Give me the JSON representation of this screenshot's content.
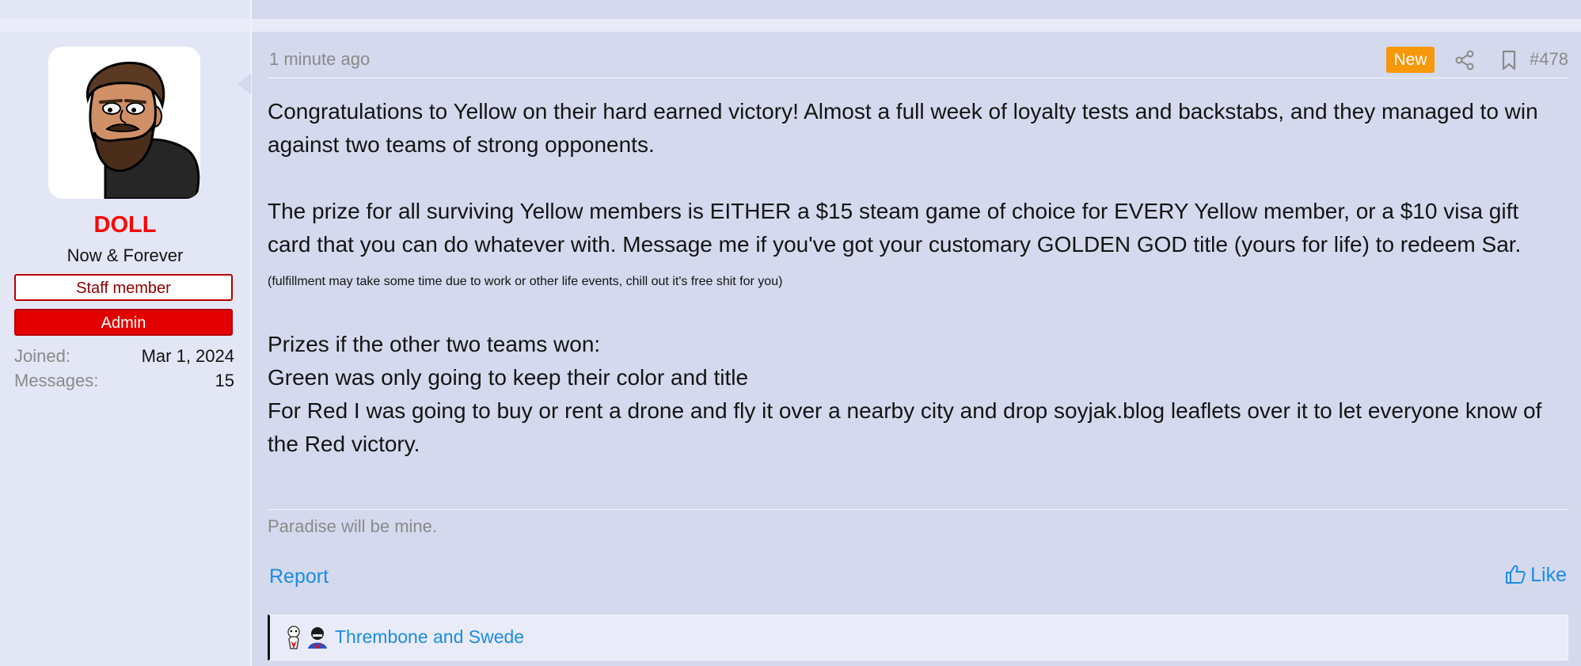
{
  "user": {
    "name": "DOLL",
    "title": "Now & Forever",
    "banners": [
      "Staff member",
      "Admin"
    ],
    "stats": [
      {
        "label": "Joined:",
        "value": "Mar 1, 2024"
      },
      {
        "label": "Messages:",
        "value": "15"
      }
    ],
    "avatar_icon": "bearded-man-avatar",
    "name_color": "#ff0000"
  },
  "post": {
    "time": "1 minute ago",
    "new_badge": "New",
    "number": "#478",
    "icons": [
      "share-icon",
      "bookmark-icon"
    ],
    "paragraph1": "Congratulations to Yellow on their hard earned victory! Almost a full week of loyalty tests and backstabs, and they managed to win against two teams of strong opponents.",
    "paragraph2": "The prize for all surviving Yellow members is EITHER a $15 steam game of choice for EVERY Yellow member, or a $10 visa gift card that you can do whatever with. Message me if you've got your customary GOLDEN GOD title (yours for life) to redeem Sar.",
    "small_note": "(fulfillment may take some time due to work or other life events, chill out it's free shit for you)",
    "lines": [
      "Prizes if the other two teams won:",
      "Green was only going to keep their color and title",
      "For Red I was going to buy or rent a drone and fly it over a nearby city and drop soyjak.blog leaflets over it to let everyone know of the Red victory."
    ],
    "signature": "Paradise will be mine."
  },
  "actions": {
    "report": "Report",
    "like": "Like"
  },
  "reactions": {
    "users": "Thrembone and Swede"
  },
  "colors": {
    "accent": "#1a8ce6",
    "new_badge": "#f7970a",
    "admin_banner": "#e30000",
    "background": "#d4d9ee"
  }
}
